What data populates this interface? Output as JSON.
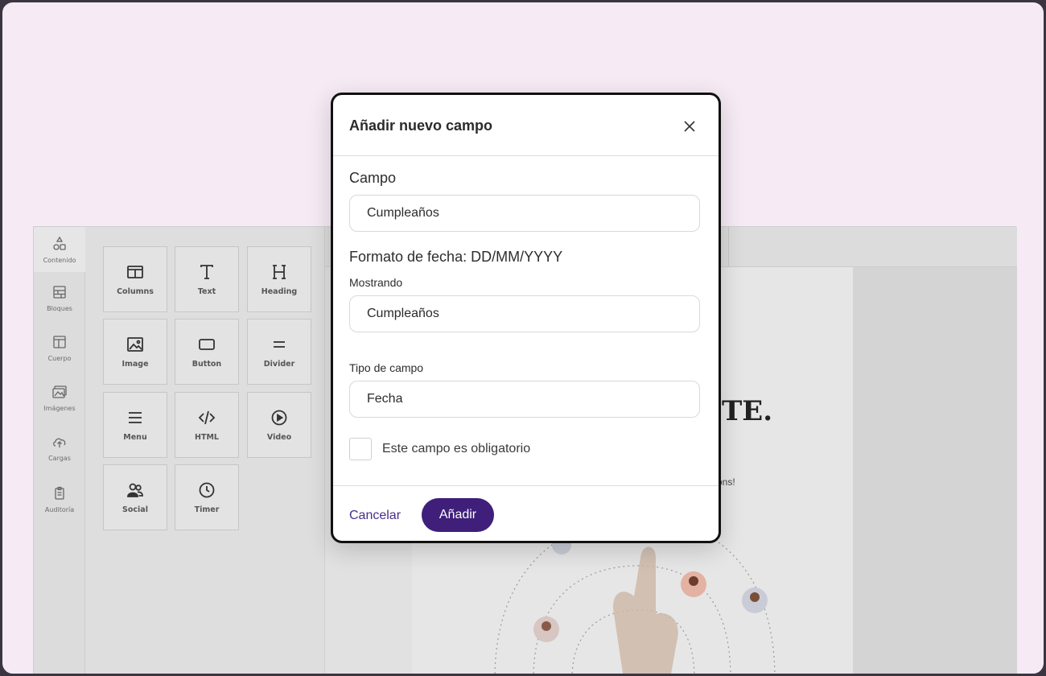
{
  "colors": {
    "page_background": "#f6ebf5",
    "frame_border": "#3a3540",
    "primary": "#3f1f7a",
    "link": "#4a2e8a",
    "modal_border": "#111111"
  },
  "editor": {
    "sidebar": {
      "items": [
        {
          "label": "Contenido",
          "icon": "shapes-icon"
        },
        {
          "label": "Bloques",
          "icon": "blocks-icon"
        },
        {
          "label": "Cuerpo",
          "icon": "layout-icon"
        },
        {
          "label": "Imágenes",
          "icon": "images-icon"
        },
        {
          "label": "Cargas",
          "icon": "cloud-upload-icon"
        },
        {
          "label": "Auditoría",
          "icon": "clipboard-icon"
        }
      ]
    },
    "tools": [
      {
        "label": "Columns",
        "icon": "columns-icon"
      },
      {
        "label": "Text",
        "icon": "text-icon"
      },
      {
        "label": "Heading",
        "icon": "heading-icon"
      },
      {
        "label": "Image",
        "icon": "image-icon"
      },
      {
        "label": "Button",
        "icon": "button-icon"
      },
      {
        "label": "Divider",
        "icon": "divider-icon"
      },
      {
        "label": "Menu",
        "icon": "menu-icon"
      },
      {
        "label": "HTML",
        "icon": "code-icon"
      },
      {
        "label": "Video",
        "icon": "play-icon"
      },
      {
        "label": "Social",
        "icon": "users-icon"
      },
      {
        "label": "Timer",
        "icon": "clock-icon"
      }
    ],
    "canvas": {
      "heading_fragment": "TE.",
      "text_fragment": "ons!"
    }
  },
  "modal": {
    "title": "Añadir nuevo campo",
    "close_icon": "close-icon",
    "field_section_label": "Campo",
    "field_value": "Cumpleaños",
    "date_format_label": "Formato de fecha: DD/MM/YYYY",
    "display_label": "Mostrando",
    "display_value": "Cumpleaños",
    "type_label": "Tipo de campo",
    "type_value": "Fecha",
    "required_label": "Este campo es obligatorio",
    "required_checked": false,
    "cancel_label": "Cancelar",
    "submit_label": "Añadir"
  }
}
